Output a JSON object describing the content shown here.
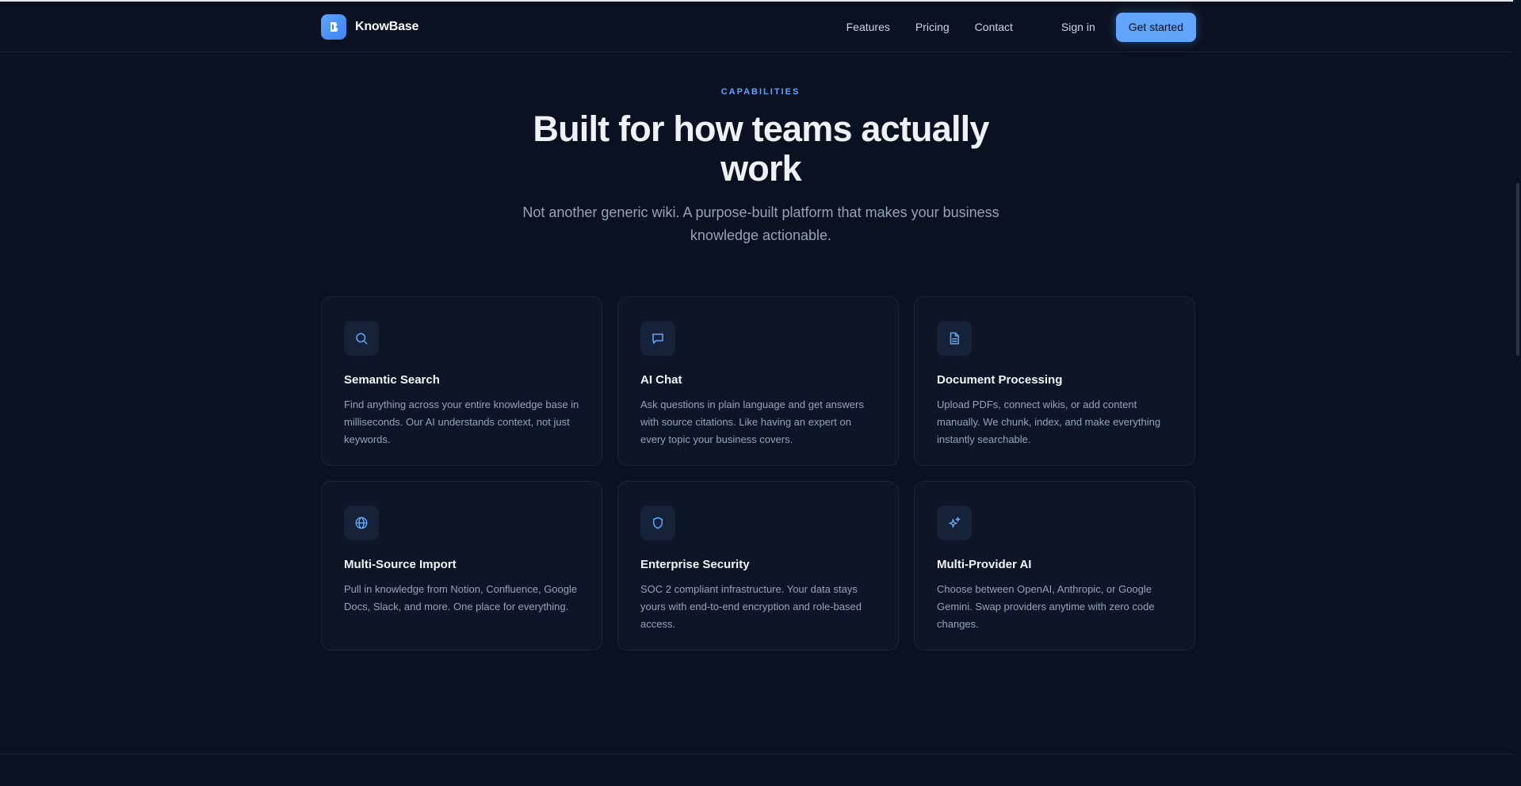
{
  "nav": {
    "brand": "KnowBase",
    "links": [
      {
        "label": "Features"
      },
      {
        "label": "Pricing"
      },
      {
        "label": "Contact"
      }
    ],
    "signin_label": "Sign in",
    "cta_label": "Get started"
  },
  "hero": {
    "eyebrow": "CAPABILITIES",
    "title": "Built for how teams actually work",
    "subtitle": "Not another generic wiki. A purpose-built platform that makes your business knowledge actionable."
  },
  "features": [
    {
      "icon": "search-icon",
      "title": "Semantic Search",
      "description": "Find anything across your entire knowledge base in milliseconds. Our AI understands context, not just keywords."
    },
    {
      "icon": "chat-icon",
      "title": "AI Chat",
      "description": "Ask questions in plain language and get answers with source citations. Like having an expert on every topic your business covers."
    },
    {
      "icon": "document-icon",
      "title": "Document Processing",
      "description": "Upload PDFs, connect wikis, or add content manually. We chunk, index, and make everything instantly searchable."
    },
    {
      "icon": "globe-icon",
      "title": "Multi-Source Import",
      "description": "Pull in knowledge from Notion, Confluence, Google Docs, Slack, and more. One place for everything."
    },
    {
      "icon": "shield-icon",
      "title": "Enterprise Security",
      "description": "SOC 2 compliant infrastructure. Your data stays yours with end-to-end encryption and role-based access."
    },
    {
      "icon": "sparkles-icon",
      "title": "Multi-Provider AI",
      "description": "Choose between OpenAI, Anthropic, or Google Gemini. Swap providers anytime with zero code changes."
    }
  ],
  "colors": {
    "background": "#0b1120",
    "accent": "#60a5fa",
    "card": "#0e1526"
  }
}
